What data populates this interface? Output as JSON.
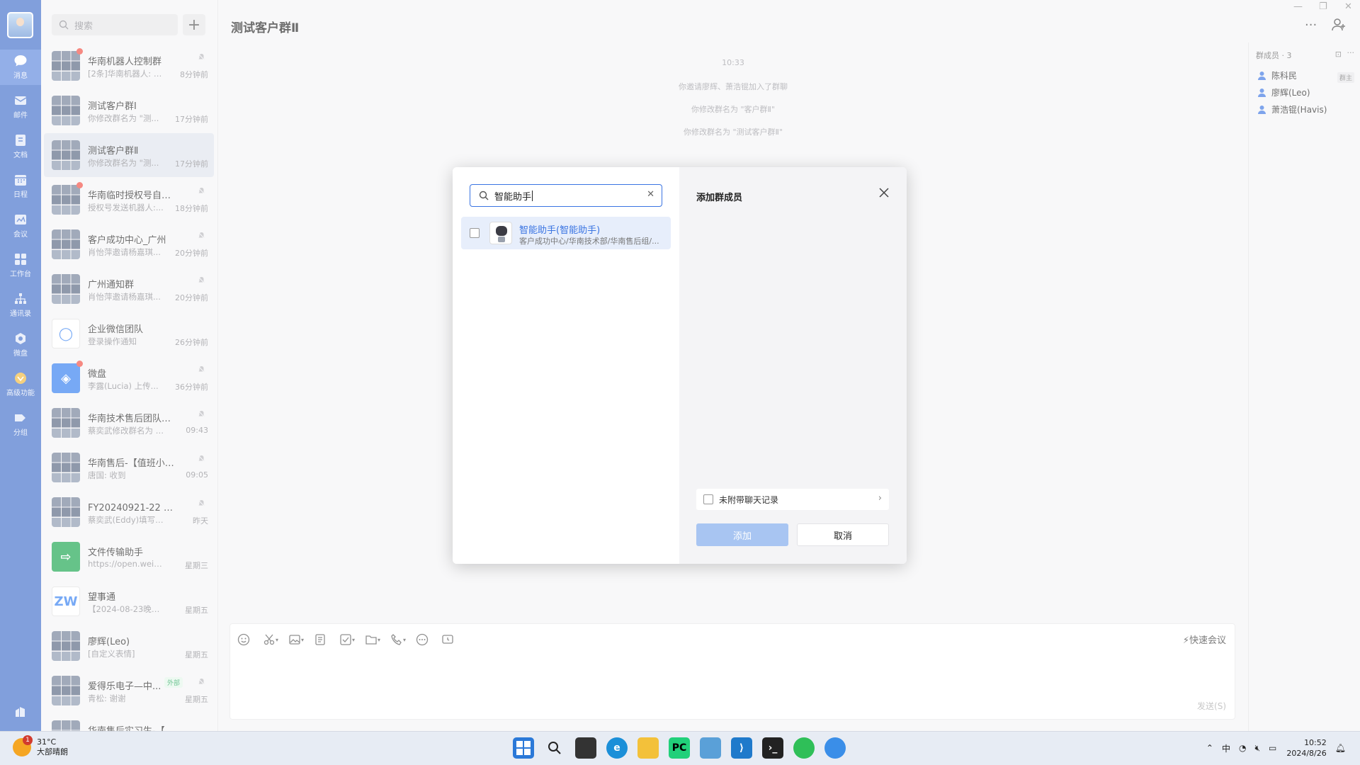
{
  "app": {
    "title": "测试客户群Ⅱ"
  },
  "rail": {
    "items": [
      {
        "label": "消息",
        "icon": "chat-bubble-icon"
      },
      {
        "label": "邮件",
        "icon": "mail-icon"
      },
      {
        "label": "文档",
        "icon": "document-icon"
      },
      {
        "label": "日程",
        "icon": "calendar-icon"
      },
      {
        "label": "会议",
        "icon": "meeting-icon"
      },
      {
        "label": "工作台",
        "icon": "workbench-icon"
      },
      {
        "label": "通讯录",
        "icon": "contacts-icon"
      },
      {
        "label": "微盘",
        "icon": "drive-icon"
      },
      {
        "label": "高级功能",
        "icon": "premium-icon"
      },
      {
        "label": "分组",
        "icon": "tag-icon"
      }
    ]
  },
  "search": {
    "placeholder": "搜索"
  },
  "chats": [
    {
      "name": "华南机器人控制群",
      "preview": "[2条]华南机器人: 东...",
      "time": "8分钟前",
      "unread": true,
      "muted": true,
      "avatar": "grid"
    },
    {
      "name": "测试客户群Ⅰ",
      "preview": "你修改群名为 \"测...",
      "time": "17分钟前",
      "unread": false,
      "muted": false,
      "avatar": "grid"
    },
    {
      "name": "测试客户群Ⅱ",
      "preview": "你修改群名为 \"测...",
      "time": "17分钟前",
      "unread": false,
      "muted": false,
      "avatar": "grid",
      "active": true
    },
    {
      "name": "华南临时授权号自助申...",
      "preview": "授权号发送机器人:...",
      "time": "18分钟前",
      "unread": true,
      "muted": true,
      "avatar": "grid"
    },
    {
      "name": "客户成功中心_广州",
      "preview": "肖怡萍邀请杨嘉琪...",
      "time": "20分钟前",
      "unread": false,
      "muted": true,
      "avatar": "grid"
    },
    {
      "name": "广州通知群",
      "preview": "肖怡萍邀请杨嘉琪...",
      "time": "20分钟前",
      "unread": false,
      "muted": true,
      "avatar": "grid"
    },
    {
      "name": "企业微信团队",
      "preview": "登录操作通知",
      "time": "26分钟前",
      "unread": false,
      "muted": false,
      "avatar": "white"
    },
    {
      "name": "微盘",
      "preview": "李露(Lucia) 上传...",
      "time": "36分钟前",
      "unread": true,
      "muted": true,
      "avatar": "blue"
    },
    {
      "name": "华南技术售后团队【蔡...",
      "preview": "蔡奕武修改群名为 \"...",
      "time": "09:43",
      "unread": false,
      "muted": true,
      "avatar": "grid"
    },
    {
      "name": "华南售后-【值班小组...",
      "preview": "唐国: 收到",
      "time": "09:05",
      "unread": false,
      "muted": true,
      "avatar": "grid"
    },
    {
      "name": "FY20240921-22 华南...",
      "preview": "蔡奕武(Eddy)填写了收...",
      "time": "昨天",
      "unread": false,
      "muted": true,
      "avatar": "grid"
    },
    {
      "name": "文件传输助手",
      "preview": "https://open.weixin...",
      "time": "星期三",
      "unread": false,
      "muted": false,
      "avatar": "green"
    },
    {
      "name": "望事通",
      "preview": "【2024-08-23晚】E...",
      "time": "星期五",
      "unread": false,
      "muted": false,
      "avatar": "zw"
    },
    {
      "name": "廖辉(Leo)",
      "preview": "[自定义表情]",
      "time": "星期五",
      "unread": false,
      "muted": false,
      "avatar": "grid"
    },
    {
      "name": "爱得乐电子—中...",
      "preview": "青松: 谢谢",
      "time": "星期五",
      "unread": false,
      "muted": true,
      "avatar": "grid",
      "tag": "外部"
    },
    {
      "name": "华南售后实习生-【陈科民",
      "preview": "",
      "time": "",
      "unread": false,
      "muted": false,
      "avatar": "grid"
    }
  ],
  "messages": {
    "time": "10:33",
    "system": [
      "你邀请廖辉、萧浩锟加入了群聊",
      "你修改群名为 \"客户群Ⅱ\"",
      "你修改群名为 \"测试客户群Ⅱ\""
    ]
  },
  "members": {
    "header": "群成员 · 3",
    "owner_label": "群主",
    "list": [
      "陈科民",
      "廖辉(Leo)",
      "萧浩锟(Havis)"
    ]
  },
  "composer": {
    "quick_meeting": "快速会议",
    "send": "发送(S)"
  },
  "dialog": {
    "search_value": "智能助手",
    "title": "添加群成员",
    "result": {
      "name": "智能助手(智能助手)",
      "desc": "客户成功中心/华南技术部/华南售后组/..."
    },
    "history_label": "未附带聊天记录",
    "add_button": "添加",
    "cancel_button": "取消"
  },
  "taskbar": {
    "weather_badge": "1",
    "temperature": "31°C",
    "weather": "大部晴朗",
    "ime": "中",
    "time": "10:52",
    "date": "2024/8/26"
  },
  "colors": {
    "rail": "#3e6cc9",
    "accent": "#3a74e2",
    "unread": "#f24a3f"
  }
}
